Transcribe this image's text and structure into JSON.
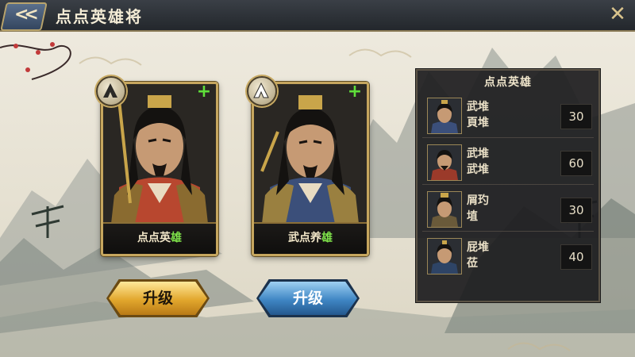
{
  "header": {
    "title": "点点英雄将",
    "back_label": "<<",
    "close_label": "✕"
  },
  "heroes": [
    {
      "name_prefix": "点点英",
      "name_highlight": "雄",
      "badge_icon": "camp-tent-icon-dark",
      "plus": "+",
      "armor_color": "#b8472f"
    },
    {
      "name_prefix": "武点养",
      "name_highlight": "雄",
      "badge_icon": "camp-tent-icon-white",
      "plus": "+",
      "armor_color": "#3b4f7a"
    }
  ],
  "buttons": {
    "upgrade_1": "升级",
    "upgrade_2": "升级"
  },
  "panel": {
    "title": "点点英雄",
    "rows": [
      {
        "line1": "武堆",
        "line2": "頁堆",
        "value": "30",
        "armor_color": "#3b4f7a"
      },
      {
        "line1": "武堆",
        "line2": "武堆",
        "value": "60",
        "armor_color": "#9b3a2a"
      },
      {
        "line1": "屑玓",
        "line2": "埴",
        "value": "30",
        "armor_color": "#6a5a3a"
      },
      {
        "line1": "屁堆",
        "line2": "莅",
        "value": "40",
        "armor_color": "#2e4466"
      }
    ]
  },
  "colors": {
    "gold": "#c6a65e",
    "highlight_green": "#7ee24a",
    "plus_green": "#5fe03a"
  }
}
